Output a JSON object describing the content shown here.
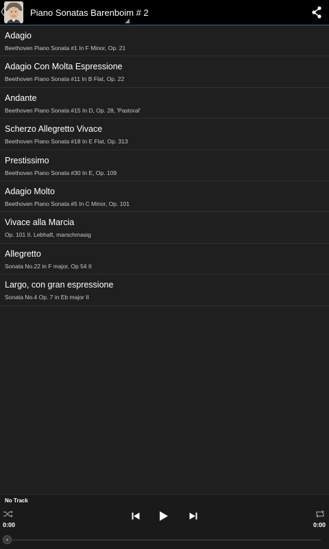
{
  "actionbar": {
    "title": "Piano Sonatas Barenboim # 2",
    "back_icon": "chevron-left-icon",
    "share_icon": "share-icon"
  },
  "tracks": [
    {
      "title": "Adagio",
      "subtitle": "Beethoven Piano Sonata #1 In F Minor, Op. 21"
    },
    {
      "title": "Adagio Con Molta Espressione",
      "subtitle": "Beethoven Piano Sonata #11 In B Flat, Op. 22"
    },
    {
      "title": "Andante",
      "subtitle": "Beethoven Piano Sonata #15 In D, Op. 28, 'Pastoral'"
    },
    {
      "title": "Scherzo Allegretto Vivace",
      "subtitle": "Beethoven Piano Sonata #18 In E Flat, Op. 313"
    },
    {
      "title": "Prestissimo",
      "subtitle": "Beethoven Piano Sonata #30 In E, Op. 109"
    },
    {
      "title": "Adagio Molto",
      "subtitle": "Beethoven Piano Sonata #5 In C Minor, Op. 101"
    },
    {
      "title": "Vivace alla Marcia",
      "subtitle": "Op. 101 II. Lebhaft, marschmasig"
    },
    {
      "title": "Allegretto",
      "subtitle": "Sonata No.22 in F major, Op 54 II"
    },
    {
      "title": "Largo, con gran espressione",
      "subtitle": "Sonata No.4 Op. 7 in Eb major II"
    }
  ],
  "player": {
    "now_playing": "No Track",
    "elapsed": "0:00",
    "duration": "0:00",
    "progress": 0,
    "accent": "#4aa3c0"
  }
}
